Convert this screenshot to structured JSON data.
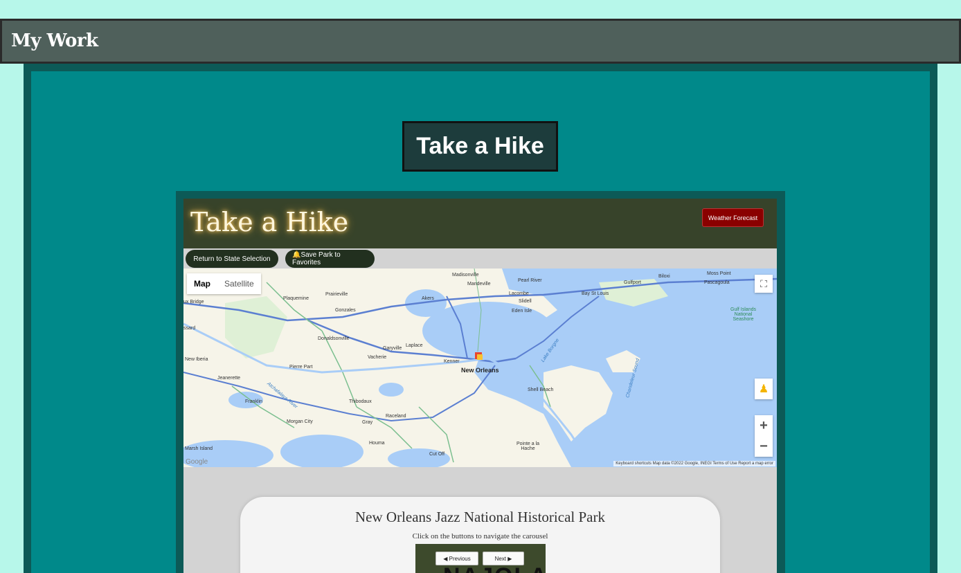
{
  "header": {
    "title": "My Work"
  },
  "project": {
    "title": "Take a Hike"
  },
  "app": {
    "logo": "Take a Hike",
    "weather_button": "Weather Forecast",
    "return_button": "Return to State Selection",
    "save_button": "🔔Save Park to Favorites"
  },
  "map": {
    "map_label": "Map",
    "satellite_label": "Satellite",
    "main_city": "New Orleans",
    "labels": {
      "madisonville": "Madisonville",
      "pearl_river": "Pearl River",
      "mandeville": "Mandeville",
      "lacombe": "Lacombe",
      "slidell": "Slidell",
      "eden_isle": "Eden Isle",
      "bay_st_louis": "Bay St Louis",
      "gulfport": "Gulfport",
      "biloxi": "Biloxi",
      "moss_point": "Moss Point",
      "pascagoula": "Pascagoula",
      "gulf_islands": "Gulf Islands National Seashore",
      "plaquemine": "Plaquemine",
      "prairieville": "Prairieville",
      "akers": "Akers",
      "gonzales": "Gonzales",
      "breaux_bridge": "ux Bridge",
      "donaldsonville": "Donaldsonville",
      "garyville": "Garyville",
      "laplace": "Laplace",
      "vacherie": "Vacherie",
      "kenner": "Kenner",
      "new_iberia": "New Iberia",
      "pierre_part": "Pierre Part",
      "jeanerette": "Jeanerette",
      "thibodaux": "Thibodaux",
      "franklin": "Franklin",
      "raceland": "Raceland",
      "morgan_city": "Morgan City",
      "gray": "Gray",
      "houma": "Houma",
      "cut_off": "Cut Off",
      "shell_beach": "Shell Beach",
      "pointe_a_la_hache": "Pointe a la Hache",
      "marsh_island": "Marsh Island",
      "lake_borgne": "Lake Borgne",
      "chandeleur_sound": "Chandeleur Sound",
      "atchafalaya": "Atchafalaya River",
      "bayard": "ssard",
      "google": "Google"
    },
    "footer": "Keyboard shortcuts   Map data ©2022 Google, INEGI   Terms of Use   Report a map error",
    "zoom_in": "+",
    "zoom_out": "−"
  },
  "carousel": {
    "park_name": "New Orleans Jazz National Historical Park",
    "instructions": "Click on the buttons to navigate the carousel",
    "prev_label": "◀ Previous",
    "next_label": "Next ▶",
    "image_text": "NAJOLA"
  },
  "colors": {
    "page_bg": "#b7f7ea",
    "topbar": "#4f605b",
    "teal": "#00898a",
    "dark_teal": "#0c5a57",
    "app_header": "#37432a",
    "weather": "#8a0000"
  }
}
